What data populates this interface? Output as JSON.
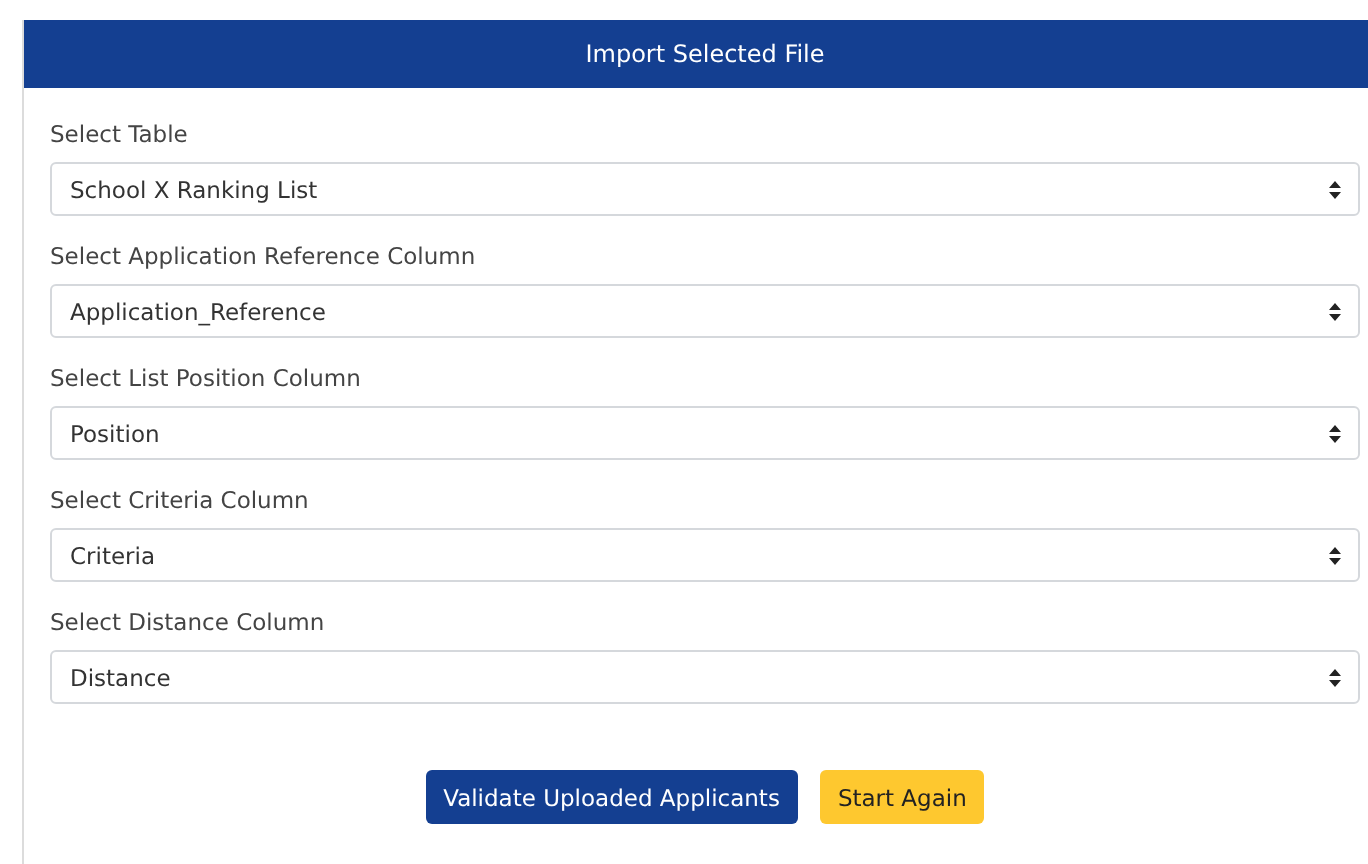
{
  "card": {
    "title": "Import Selected File"
  },
  "fields": [
    {
      "label": "Select Table",
      "value": "School X Ranking List"
    },
    {
      "label": "Select Application Reference Column",
      "value": "Application_Reference"
    },
    {
      "label": "Select List Position Column",
      "value": "Position"
    },
    {
      "label": "Select Criteria Column",
      "value": "Criteria"
    },
    {
      "label": "Select Distance Column",
      "value": "Distance"
    }
  ],
  "buttons": [
    {
      "label": "Validate Uploaded Applicants",
      "kind": "primary"
    },
    {
      "label": "Start Again",
      "kind": "warning"
    }
  ]
}
